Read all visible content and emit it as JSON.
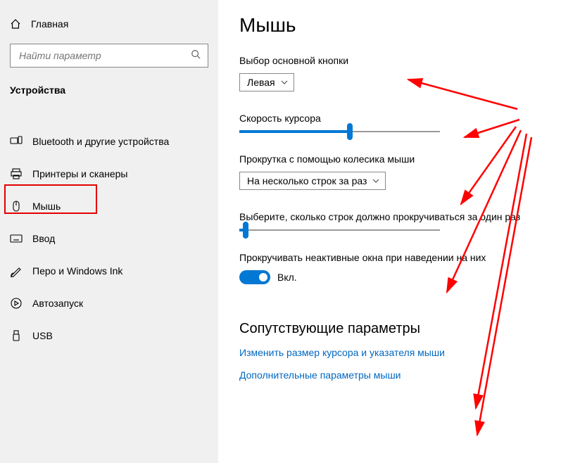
{
  "sidebar": {
    "home": "Главная",
    "search_placeholder": "Найти параметр",
    "category": "Устройства",
    "items": [
      {
        "label": "Bluetooth и другие устройства"
      },
      {
        "label": "Принтеры и сканеры"
      },
      {
        "label": "Мышь"
      },
      {
        "label": "Ввод"
      },
      {
        "label": "Перо и Windows Ink"
      },
      {
        "label": "Автозапуск"
      },
      {
        "label": "USB"
      }
    ]
  },
  "page": {
    "title": "Мышь",
    "primary_button": {
      "label": "Выбор основной кнопки",
      "value": "Левая"
    },
    "cursor_speed": {
      "label": "Скорость курсора",
      "value": 55
    },
    "scroll_wheel": {
      "label": "Прокрутка с помощью колесика мыши",
      "value": "На несколько строк за раз"
    },
    "lines_per_scroll": {
      "label": "Выберите, сколько строк должно прокручиваться за один раз",
      "value": 3
    },
    "scroll_inactive": {
      "label": "Прокручивать неактивные окна при наведении на них",
      "state_label": "Вкл.",
      "on": true
    },
    "related": {
      "heading": "Сопутствующие параметры",
      "link1": "Изменить размер курсора и указателя мыши",
      "link2": "Дополнительные параметры мыши"
    }
  }
}
